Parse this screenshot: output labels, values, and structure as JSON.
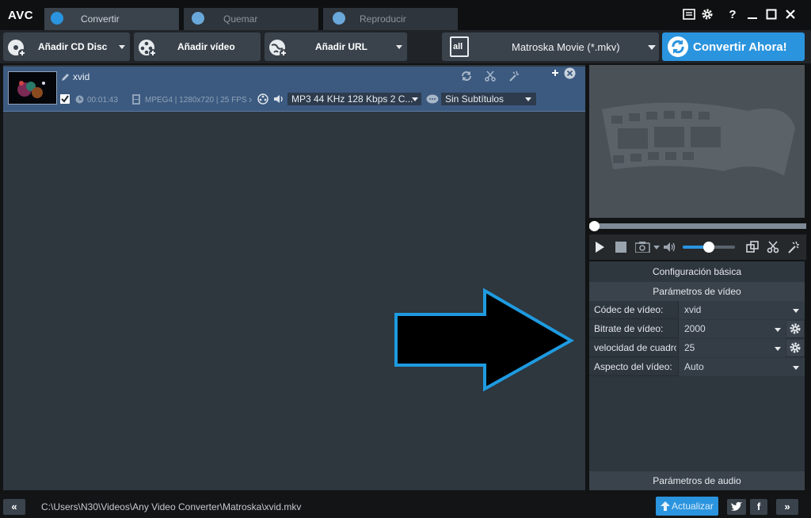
{
  "app": {
    "logo": "AVC"
  },
  "tabs": [
    {
      "label": "Convertir",
      "active": true
    },
    {
      "label": "Quemar",
      "active": false
    },
    {
      "label": "Reproducir",
      "active": false
    }
  ],
  "window_controls": {
    "help": "?"
  },
  "toolbar": {
    "add_cd": "Añadir CD Disc",
    "add_video": "Añadir vídeo",
    "add_url": "Añadir URL",
    "format": "Matroska Movie (*.mkv)",
    "format_icon_text": "all",
    "convert": "Convertir Ahora!"
  },
  "file": {
    "name": "xvid",
    "duration": "00:01:43",
    "video_info": "MPEG4 | 1280x720 | 25 FPS",
    "audio": "MP3 44 KHz 128 Kbps 2 C...",
    "subtitles": "Sin Subtítulos",
    "checked": true
  },
  "player": {
    "seek_progress": 0,
    "volume_level": 0.5
  },
  "settings": {
    "basic_header": "Configuración básica",
    "video_header": "Parámetros de vídeo",
    "audio_header": "Parámetros de audio",
    "rows": [
      {
        "label": "Códec de vídeo:",
        "value": "xvid"
      },
      {
        "label": "Bitrate de vídeo:",
        "value": "2000"
      },
      {
        "label": "velocidad de cuadros:",
        "value": "25"
      },
      {
        "label": "Aspecto del vídeo:",
        "value": "Auto"
      }
    ]
  },
  "status": {
    "path": "C:\\Users\\N30\\Videos\\Any Video Converter\\Matroska\\xvid.mkv",
    "update": "Actualizar"
  },
  "colors": {
    "accent": "#2b94de",
    "selected_row": "#3c5a80",
    "arrow_outline": "#1e9be0"
  }
}
